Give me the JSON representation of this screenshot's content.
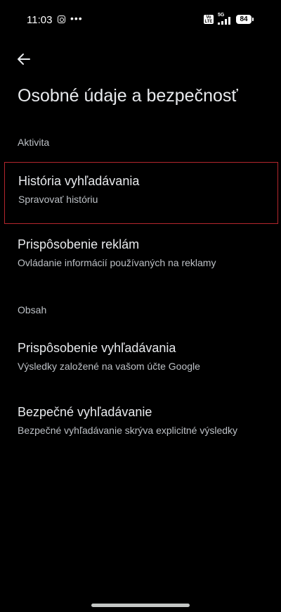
{
  "status_bar": {
    "time": "11:03",
    "network": "5G",
    "volte": "Vo LTE",
    "battery": "84",
    "icons": [
      "instagram-icon",
      "more-icon",
      "volte-icon",
      "signal-icon",
      "battery-icon"
    ]
  },
  "header": {
    "back_icon": "arrow-back-icon",
    "title": "Osobné údaje a bezpečnosť"
  },
  "sections": [
    {
      "header": "Aktivita",
      "items": [
        {
          "title": "História vyhľadávania",
          "subtitle": "Spravovať históriu"
        },
        {
          "title": "Prispôsobenie reklám",
          "subtitle": "Ovládanie informácií používaných na reklamy"
        }
      ]
    },
    {
      "header": "Obsah",
      "items": [
        {
          "title": "Prispôsobenie vyhľadávania",
          "subtitle": "Výsledky založené na vašom účte Google"
        },
        {
          "title": "Bezpečné vyhľadávanie",
          "subtitle": "Bezpečné vyhľadávanie skrýva explicitné výsledky"
        }
      ]
    }
  ],
  "colors": {
    "background": "#000000",
    "primary_text": "#e8eaed",
    "secondary_text": "#bdc1c6",
    "highlight_border": "#b3262d"
  }
}
